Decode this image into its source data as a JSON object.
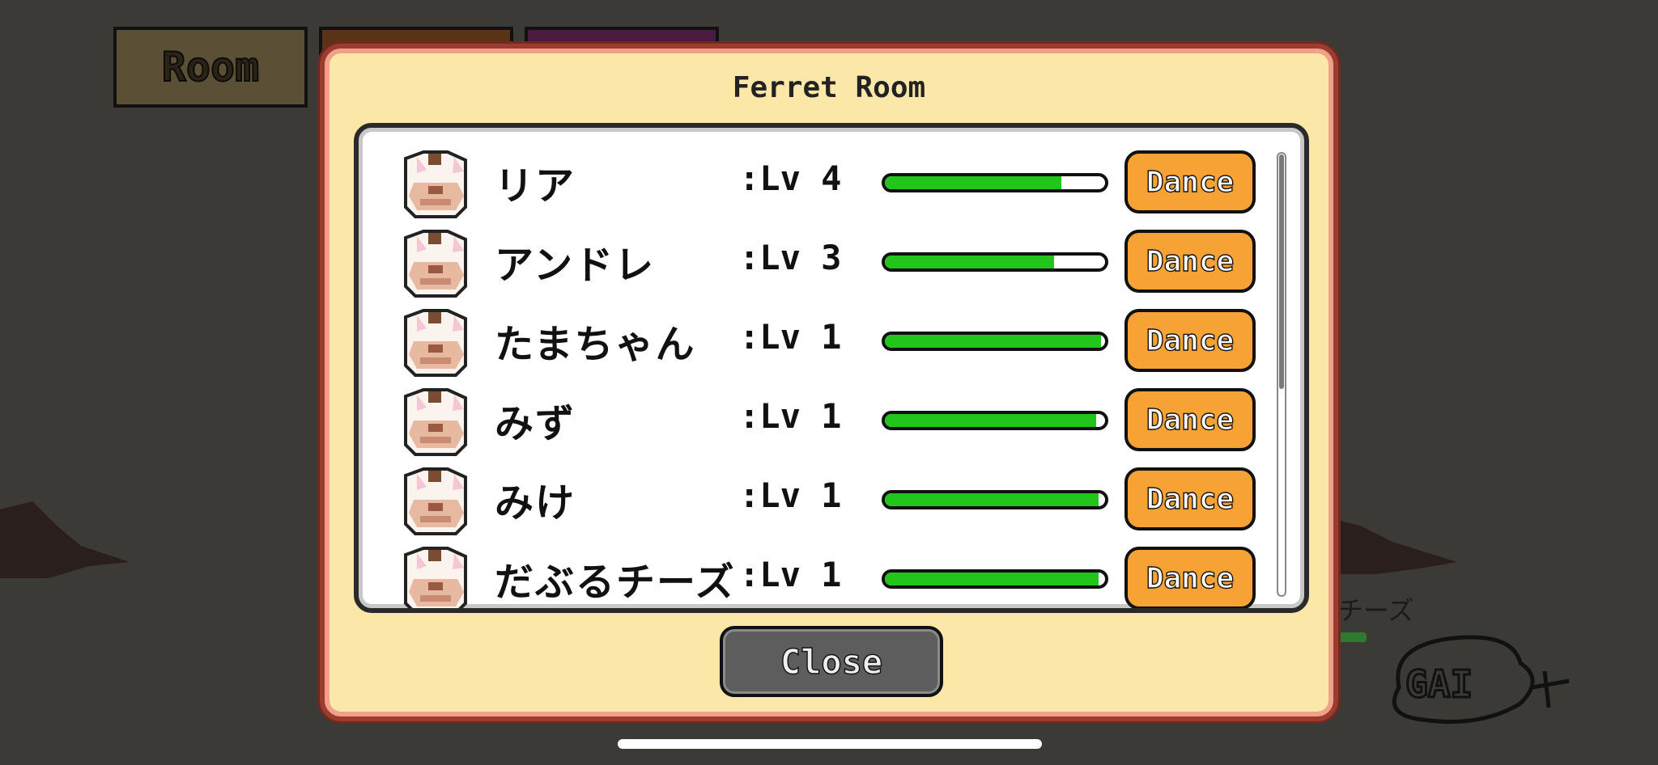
{
  "tabs": {
    "room_label": "Room"
  },
  "modal": {
    "title": "Ferret Room",
    "close_label": "Close",
    "ferrets": [
      {
        "name": "リア",
        "level": ":Lv 4",
        "progress": 0.8,
        "action": "Dance"
      },
      {
        "name": "アンドレ",
        "level": ":Lv 3",
        "progress": 0.77,
        "action": "Dance"
      },
      {
        "name": "たまちゃん",
        "level": ":Lv 1",
        "progress": 0.98,
        "action": "Dance"
      },
      {
        "name": "みず",
        "level": ":Lv 1",
        "progress": 0.96,
        "action": "Dance"
      },
      {
        "name": "みけ",
        "level": ":Lv 1",
        "progress": 0.97,
        "action": "Dance"
      },
      {
        "name": "だぶるチーズ",
        "level": ":Lv 1",
        "progress": 0.97,
        "action": "Dance"
      }
    ]
  },
  "background": {
    "ferret_label": "チーズ",
    "logo_text": "GAI"
  },
  "colors": {
    "background": "#3b3a36",
    "panel": "#fbe7a8",
    "panel_border": "#9a3c2e",
    "progress": "#22c61b",
    "dance_button": "#f7a234",
    "close_button": "#5d5d5d"
  }
}
